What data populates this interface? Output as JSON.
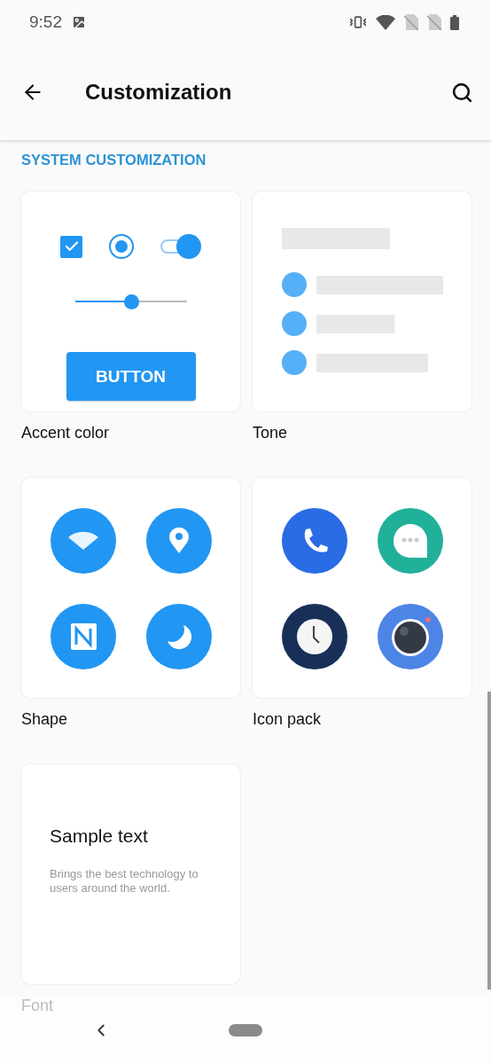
{
  "status_bar": {
    "time": "9:52"
  },
  "app_bar": {
    "title": "Customization"
  },
  "section": {
    "title": "SYSTEM CUSTOMIZATION"
  },
  "cards": [
    {
      "kind": "accent",
      "label": "Accent color",
      "preview": {
        "checkbox": {
          "checked": true
        },
        "radio": {
          "selected": true
        },
        "switch": {
          "on": true
        },
        "slider": {
          "level": 0.5
        },
        "button": {
          "label": "BUTTON"
        }
      }
    },
    {
      "kind": "tone",
      "label": "Tone"
    },
    {
      "kind": "shape",
      "label": "Shape"
    },
    {
      "kind": "icons",
      "label": "Icon pack"
    },
    {
      "kind": "font",
      "label": "Font",
      "sample": "Sample text",
      "description": "Brings the best technology to users around the world."
    }
  ]
}
